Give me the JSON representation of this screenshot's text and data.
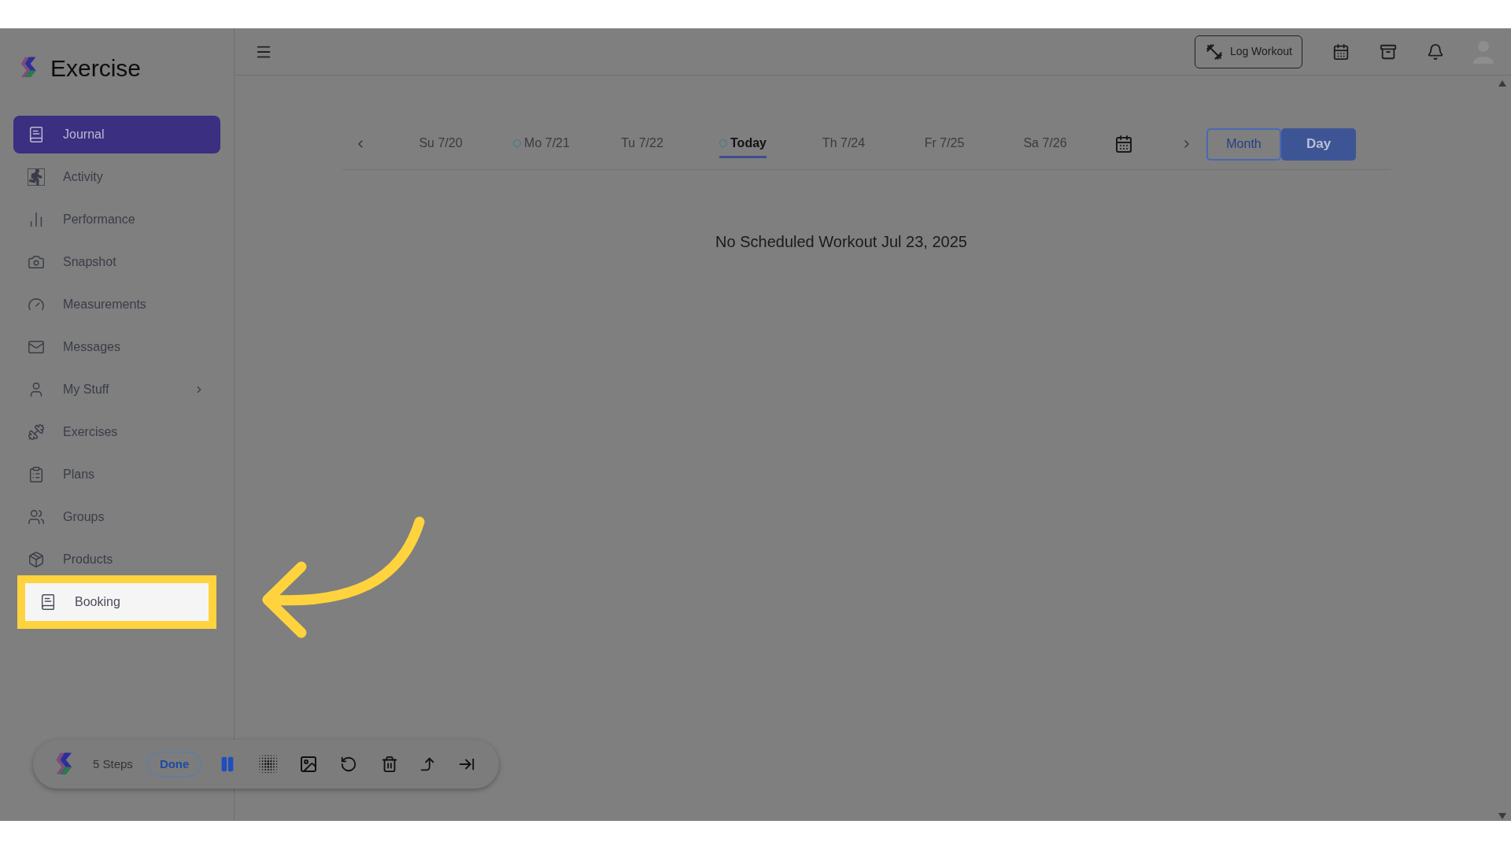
{
  "app": {
    "name": "Exercise"
  },
  "sidebar": {
    "items": [
      {
        "label": "Journal",
        "selected": true,
        "highlighted": false,
        "has_submenu": false
      },
      {
        "label": "Activity",
        "selected": false,
        "highlighted": false,
        "has_submenu": false
      },
      {
        "label": "Performance",
        "selected": false,
        "highlighted": false,
        "has_submenu": false
      },
      {
        "label": "Snapshot",
        "selected": false,
        "highlighted": false,
        "has_submenu": false
      },
      {
        "label": "Measurements",
        "selected": false,
        "highlighted": false,
        "has_submenu": false
      },
      {
        "label": "Messages",
        "selected": false,
        "highlighted": false,
        "has_submenu": false
      },
      {
        "label": "My Stuff",
        "selected": false,
        "highlighted": false,
        "has_submenu": true
      },
      {
        "label": "Exercises",
        "selected": false,
        "highlighted": false,
        "has_submenu": false
      },
      {
        "label": "Plans",
        "selected": false,
        "highlighted": false,
        "has_submenu": false
      },
      {
        "label": "Groups",
        "selected": false,
        "highlighted": false,
        "has_submenu": false
      },
      {
        "label": "Products",
        "selected": false,
        "highlighted": false,
        "has_submenu": false
      },
      {
        "label": "Booking",
        "selected": false,
        "highlighted": true,
        "has_submenu": false
      }
    ]
  },
  "header": {
    "log_workout_button": "Log Workout"
  },
  "day_strip": {
    "days": [
      {
        "label": "Su 7/20",
        "selected": false,
        "has_dot": false
      },
      {
        "label": "Mo 7/21",
        "selected": false,
        "has_dot": true
      },
      {
        "label": "Tu 7/22",
        "selected": false,
        "has_dot": false
      },
      {
        "label": "Today",
        "selected": true,
        "has_dot": true
      },
      {
        "label": "Th 7/24",
        "selected": false,
        "has_dot": false
      },
      {
        "label": "Fr 7/25",
        "selected": false,
        "has_dot": false
      },
      {
        "label": "Sa 7/26",
        "selected": false,
        "has_dot": false
      }
    ],
    "view_toggle": [
      {
        "label": "Month",
        "selected": false
      },
      {
        "label": "Day",
        "selected": true
      }
    ]
  },
  "message": "No Scheduled Workout Jul 23, 2025",
  "recorder_toolbar": {
    "steps": "5 Steps",
    "done_button": "Done"
  }
}
